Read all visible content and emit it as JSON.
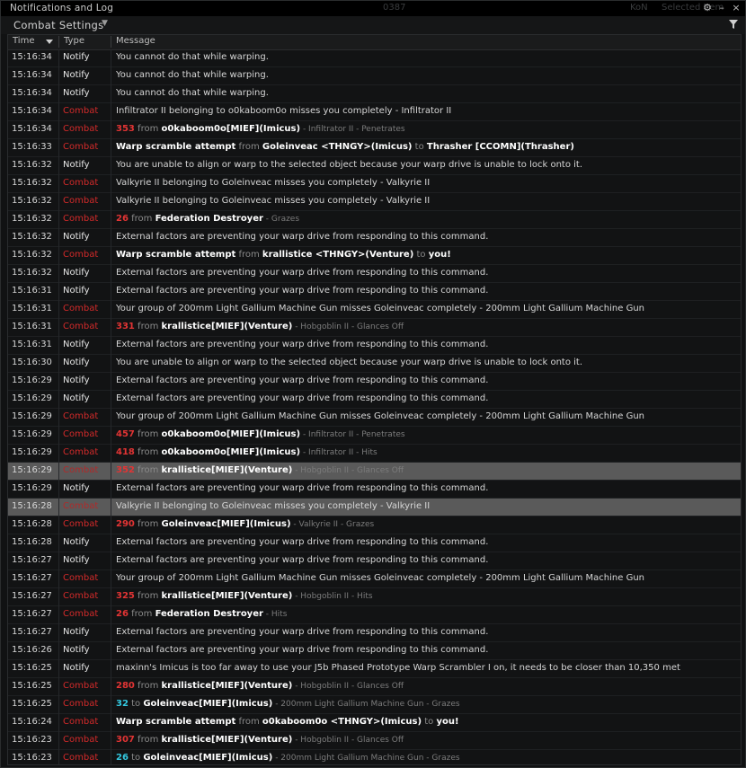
{
  "window": {
    "title": "Notifications and Log",
    "background_ghost_texts": [
      "0387",
      "KoN",
      "Selected Item",
      "Compare Item"
    ]
  },
  "settings": {
    "label": "Combat Settings"
  },
  "columns": {
    "time": "Time",
    "type": "Type",
    "message": "Message"
  },
  "colors": {
    "combat": "#d22a2a",
    "damage": "#e23434",
    "damage_cyan": "#33c8e0",
    "selected_row": "#5a5a5a"
  },
  "rows": [
    {
      "time": "15:16:34",
      "type": "Notify",
      "msg": [
        {
          "t": "You cannot do that while warping.",
          "c": "n"
        }
      ]
    },
    {
      "time": "15:16:34",
      "type": "Notify",
      "msg": [
        {
          "t": "You cannot do that while warping.",
          "c": "n"
        }
      ]
    },
    {
      "time": "15:16:34",
      "type": "Notify",
      "msg": [
        {
          "t": "You cannot do that while warping.",
          "c": "n"
        }
      ]
    },
    {
      "time": "15:16:34",
      "type": "Combat",
      "msg": [
        {
          "t": "Infiltrator II belonging to o0kaboom0o misses you completely - Infiltrator II",
          "c": "n"
        }
      ]
    },
    {
      "time": "15:16:34",
      "type": "Combat",
      "msg": [
        {
          "t": "353",
          "c": "r"
        },
        {
          "t": " from ",
          "c": "g"
        },
        {
          "t": "o0kaboom0o[MIEF](Imicus)",
          "c": "b"
        },
        {
          "t": " - Infiltrator II - Penetrates",
          "c": "d"
        }
      ]
    },
    {
      "time": "15:16:33",
      "type": "Combat",
      "msg": [
        {
          "t": "Warp scramble attempt",
          "c": "b"
        },
        {
          "t": " from ",
          "c": "g"
        },
        {
          "t": "Goleinveac <THNGY>(Imicus)",
          "c": "b"
        },
        {
          "t": " to ",
          "c": "g"
        },
        {
          "t": "Thrasher [CCOMN](Thrasher)",
          "c": "b"
        }
      ]
    },
    {
      "time": "15:16:32",
      "type": "Notify",
      "msg": [
        {
          "t": "You are unable to align or warp to the selected object because your warp drive is unable to lock onto it.",
          "c": "n"
        }
      ]
    },
    {
      "time": "15:16:32",
      "type": "Combat",
      "msg": [
        {
          "t": "Valkyrie II belonging to Goleinveac misses you completely - Valkyrie II",
          "c": "n"
        }
      ]
    },
    {
      "time": "15:16:32",
      "type": "Combat",
      "msg": [
        {
          "t": "Valkyrie II belonging to Goleinveac misses you completely - Valkyrie II",
          "c": "n"
        }
      ]
    },
    {
      "time": "15:16:32",
      "type": "Combat",
      "msg": [
        {
          "t": "26",
          "c": "r"
        },
        {
          "t": " from ",
          "c": "g"
        },
        {
          "t": "Federation Destroyer",
          "c": "b"
        },
        {
          "t": " - Grazes",
          "c": "d"
        }
      ]
    },
    {
      "time": "15:16:32",
      "type": "Notify",
      "msg": [
        {
          "t": "External factors are preventing your warp drive from responding to this command.",
          "c": "n"
        }
      ]
    },
    {
      "time": "15:16:32",
      "type": "Combat",
      "msg": [
        {
          "t": "Warp scramble attempt",
          "c": "b"
        },
        {
          "t": " from ",
          "c": "g"
        },
        {
          "t": "krallistice <THNGY>(Venture)",
          "c": "b"
        },
        {
          "t": " to ",
          "c": "g"
        },
        {
          "t": "you!",
          "c": "b"
        }
      ]
    },
    {
      "time": "15:16:32",
      "type": "Notify",
      "msg": [
        {
          "t": "External factors are preventing your warp drive from responding to this command.",
          "c": "n"
        }
      ]
    },
    {
      "time": "15:16:31",
      "type": "Notify",
      "msg": [
        {
          "t": "External factors are preventing your warp drive from responding to this command.",
          "c": "n"
        }
      ]
    },
    {
      "time": "15:16:31",
      "type": "Combat",
      "msg": [
        {
          "t": "Your group of 200mm Light Gallium Machine Gun misses Goleinveac completely - 200mm Light Gallium Machine Gun",
          "c": "n"
        }
      ]
    },
    {
      "time": "15:16:31",
      "type": "Combat",
      "msg": [
        {
          "t": "331",
          "c": "r"
        },
        {
          "t": " from ",
          "c": "g"
        },
        {
          "t": "krallistice[MIEF](Venture)",
          "c": "b"
        },
        {
          "t": " - Hobgoblin II - Glances Off",
          "c": "d"
        }
      ]
    },
    {
      "time": "15:16:31",
      "type": "Notify",
      "msg": [
        {
          "t": "External factors are preventing your warp drive from responding to this command.",
          "c": "n"
        }
      ]
    },
    {
      "time": "15:16:30",
      "type": "Notify",
      "msg": [
        {
          "t": "You are unable to align or warp to the selected object because your warp drive is unable to lock onto it.",
          "c": "n"
        }
      ]
    },
    {
      "time": "15:16:29",
      "type": "Notify",
      "msg": [
        {
          "t": "External factors are preventing your warp drive from responding to this command.",
          "c": "n"
        }
      ]
    },
    {
      "time": "15:16:29",
      "type": "Notify",
      "msg": [
        {
          "t": "External factors are preventing your warp drive from responding to this command.",
          "c": "n"
        }
      ]
    },
    {
      "time": "15:16:29",
      "type": "Combat",
      "msg": [
        {
          "t": "Your group of 200mm Light Gallium Machine Gun misses Goleinveac completely - 200mm Light Gallium Machine Gun",
          "c": "n"
        }
      ]
    },
    {
      "time": "15:16:29",
      "type": "Combat",
      "msg": [
        {
          "t": "457",
          "c": "r"
        },
        {
          "t": " from ",
          "c": "g"
        },
        {
          "t": "o0kaboom0o[MIEF](Imicus)",
          "c": "b"
        },
        {
          "t": " - Infiltrator II - Penetrates",
          "c": "d"
        }
      ]
    },
    {
      "time": "15:16:29",
      "type": "Combat",
      "msg": [
        {
          "t": "418",
          "c": "r"
        },
        {
          "t": " from ",
          "c": "g"
        },
        {
          "t": "o0kaboom0o[MIEF](Imicus)",
          "c": "b"
        },
        {
          "t": " - Infiltrator II - Hits",
          "c": "d"
        }
      ]
    },
    {
      "time": "15:16:29",
      "type": "Combat",
      "sel": true,
      "msg": [
        {
          "t": "352",
          "c": "r"
        },
        {
          "t": " from ",
          "c": "g"
        },
        {
          "t": "krallistice[MIEF](Venture)",
          "c": "b"
        },
        {
          "t": " - Hobgoblin II - Glances Off",
          "c": "d"
        }
      ]
    },
    {
      "time": "15:16:29",
      "type": "Notify",
      "msg": [
        {
          "t": "External factors are preventing your warp drive from responding to this command.",
          "c": "n"
        }
      ]
    },
    {
      "time": "15:16:28",
      "type": "Combat",
      "sel": true,
      "msg": [
        {
          "t": "Valkyrie II belonging to Goleinveac misses you completely - Valkyrie II",
          "c": "n"
        }
      ]
    },
    {
      "time": "15:16:28",
      "type": "Combat",
      "msg": [
        {
          "t": "290",
          "c": "r"
        },
        {
          "t": " from ",
          "c": "g"
        },
        {
          "t": "Goleinveac[MIEF](Imicus)",
          "c": "b"
        },
        {
          "t": " - Valkyrie II - Grazes",
          "c": "d"
        }
      ]
    },
    {
      "time": "15:16:28",
      "type": "Notify",
      "msg": [
        {
          "t": "External factors are preventing your warp drive from responding to this command.",
          "c": "n"
        }
      ]
    },
    {
      "time": "15:16:27",
      "type": "Notify",
      "msg": [
        {
          "t": "External factors are preventing your warp drive from responding to this command.",
          "c": "n"
        }
      ]
    },
    {
      "time": "15:16:27",
      "type": "Combat",
      "msg": [
        {
          "t": "Your group of 200mm Light Gallium Machine Gun misses Goleinveac completely - 200mm Light Gallium Machine Gun",
          "c": "n"
        }
      ]
    },
    {
      "time": "15:16:27",
      "type": "Combat",
      "msg": [
        {
          "t": "325",
          "c": "r"
        },
        {
          "t": " from ",
          "c": "g"
        },
        {
          "t": "krallistice[MIEF](Venture)",
          "c": "b"
        },
        {
          "t": " - Hobgoblin II - Hits",
          "c": "d"
        }
      ]
    },
    {
      "time": "15:16:27",
      "type": "Combat",
      "msg": [
        {
          "t": "26",
          "c": "r"
        },
        {
          "t": " from ",
          "c": "g"
        },
        {
          "t": "Federation Destroyer",
          "c": "b"
        },
        {
          "t": " - Hits",
          "c": "d"
        }
      ]
    },
    {
      "time": "15:16:27",
      "type": "Notify",
      "msg": [
        {
          "t": "External factors are preventing your warp drive from responding to this command.",
          "c": "n"
        }
      ]
    },
    {
      "time": "15:16:26",
      "type": "Notify",
      "msg": [
        {
          "t": "External factors are preventing your warp drive from responding to this command.",
          "c": "n"
        }
      ]
    },
    {
      "time": "15:16:25",
      "type": "Notify",
      "msg": [
        {
          "t": "maxinn's Imicus is too far away to use your J5b Phased Prototype Warp Scrambler I on, it needs to be closer than 10,350 met",
          "c": "n"
        }
      ]
    },
    {
      "time": "15:16:25",
      "type": "Combat",
      "msg": [
        {
          "t": "280",
          "c": "r"
        },
        {
          "t": " from ",
          "c": "g"
        },
        {
          "t": "krallistice[MIEF](Venture)",
          "c": "b"
        },
        {
          "t": " - Hobgoblin II - Glances Off",
          "c": "d"
        }
      ]
    },
    {
      "time": "15:16:25",
      "type": "Combat",
      "msg": [
        {
          "t": "32",
          "c": "c"
        },
        {
          "t": " to ",
          "c": "g"
        },
        {
          "t": "Goleinveac[MIEF](Imicus)",
          "c": "b"
        },
        {
          "t": " - 200mm Light Gallium Machine Gun - Grazes",
          "c": "d"
        }
      ]
    },
    {
      "time": "15:16:24",
      "type": "Combat",
      "msg": [
        {
          "t": "Warp scramble attempt",
          "c": "b"
        },
        {
          "t": " from ",
          "c": "g"
        },
        {
          "t": "o0kaboom0o <THNGY>(Imicus)",
          "c": "b"
        },
        {
          "t": " to ",
          "c": "g"
        },
        {
          "t": "you!",
          "c": "b"
        }
      ]
    },
    {
      "time": "15:16:23",
      "type": "Combat",
      "msg": [
        {
          "t": "307",
          "c": "r"
        },
        {
          "t": " from ",
          "c": "g"
        },
        {
          "t": "krallistice[MIEF](Venture)",
          "c": "b"
        },
        {
          "t": " - Hobgoblin II - Glances Off",
          "c": "d"
        }
      ]
    },
    {
      "time": "15:16:23",
      "type": "Combat",
      "msg": [
        {
          "t": "26",
          "c": "c"
        },
        {
          "t": " to ",
          "c": "g"
        },
        {
          "t": "Goleinveac[MIEF](Imicus)",
          "c": "b"
        },
        {
          "t": " - 200mm Light Gallium Machine Gun - Grazes",
          "c": "d"
        }
      ]
    }
  ]
}
